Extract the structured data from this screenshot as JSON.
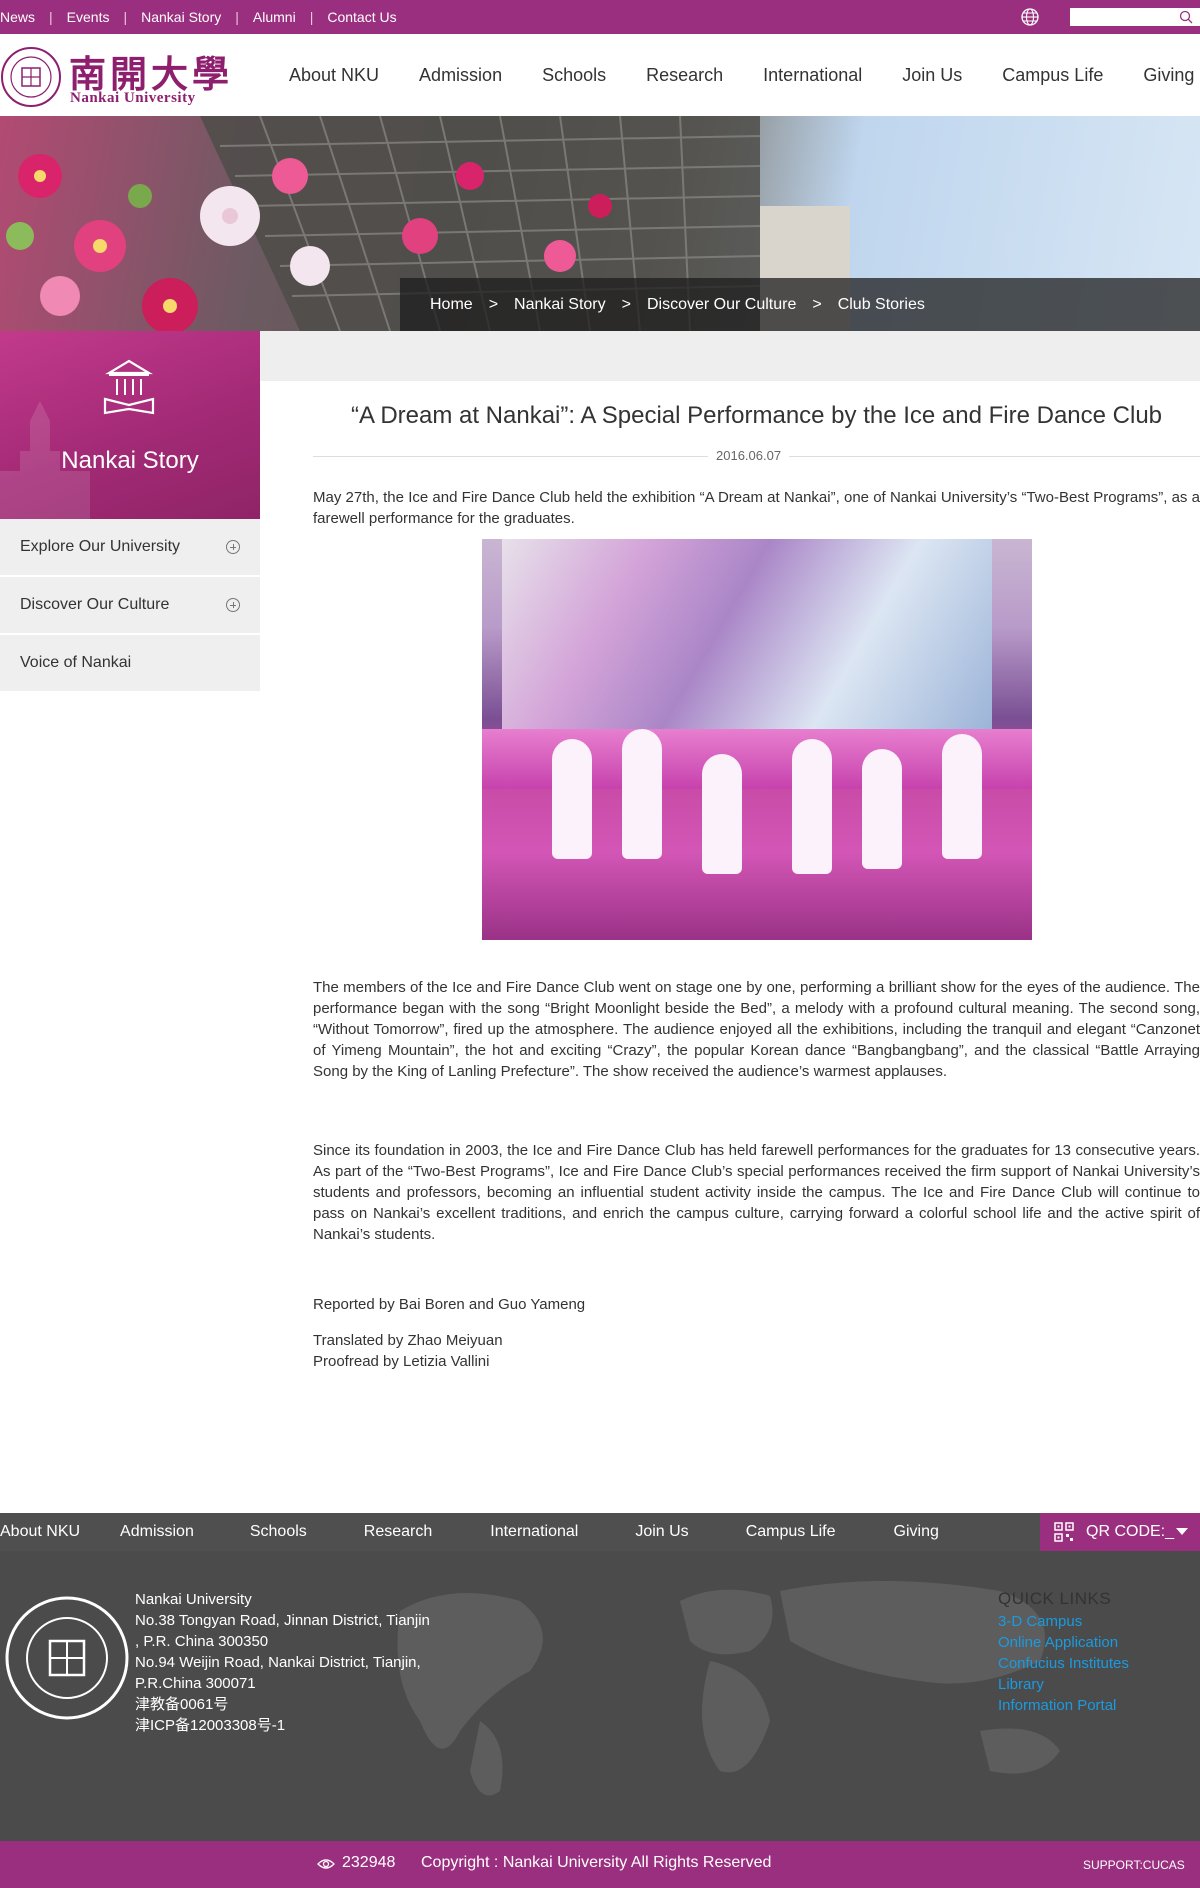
{
  "topbar": {
    "links": [
      "News",
      "Events",
      "Nankai Story",
      "Alumni",
      "Contact Us"
    ],
    "separator": "|",
    "search": {
      "placeholder": ""
    }
  },
  "header": {
    "logo_cn": "南開大學",
    "logo_en": "Nankai University",
    "nav": [
      "About NKU",
      "Admission",
      "Schools",
      "Research",
      "International",
      "Join Us",
      "Campus Life",
      "Giving"
    ]
  },
  "breadcrumb": {
    "items": [
      "Home",
      "Nankai Story",
      "Discover Our Culture",
      "Club Stories"
    ],
    "separator": ">"
  },
  "sidebar": {
    "title": "Nankai Story",
    "items": [
      {
        "label": "Explore Our University",
        "expandable": true
      },
      {
        "label": "Discover Our Culture",
        "expandable": true
      },
      {
        "label": "Voice of Nankai",
        "expandable": false
      }
    ]
  },
  "article": {
    "title": "“A Dream at Nankai”: A Special Performance by the Ice and Fire Dance Club",
    "date": "2016.06.07",
    "intro": "May 27th, the Ice and Fire Dance Club held the exhibition “A Dream at Nankai”, one of Nankai University’s “Two-Best Programs”, as a farewell performance for the graduates.",
    "body1": "The members of the Ice and Fire Dance Club went on stage one by one, performing a brilliant show for the eyes of the audience. The performance began with the song “Bright Moonlight beside the Bed”, a melody with a profound cultural meaning. The second song, “Without Tomorrow”, fired up the atmosphere. The audience enjoyed all the exhibitions, including the tranquil and elegant “Canzonet of Yimeng Mountain”, the hot and exciting “Crazy”, the popular Korean dance “Bangbangbang”, and the classical “Battle Arraying Song by the King of Lanling Prefecture”. The show received the audience’s warmest applauses.",
    "body2": "Since its foundation in 2003, the Ice and Fire Dance Club has held farewell performances for the graduates for 13 consecutive years. As part of the “Two-Best Programs”, Ice and Fire Dance Club’s special performances received the firm support of Nankai University’s students and professors, becoming an influential student activity inside the campus. The Ice and Fire Dance Club will continue to pass on Nankai’s excellent traditions, and enrich the campus culture, carrying forward a colorful school life and the active spirit of Nankai’s students.",
    "reported": "Reported by Bai Boren and Guo Yameng",
    "translated": "Translated by Zhao Meiyuan",
    "proofread": "Proofread by Letizia Vallini"
  },
  "footer_nav": {
    "items": [
      "About NKU",
      "Admission",
      "Schools",
      "Research",
      "International",
      "Join Us",
      "Campus Life",
      "Giving"
    ],
    "qr_label": "QR CODE:_"
  },
  "footer": {
    "address_lines": [
      "Nankai University",
      "No.38 Tongyan Road, Jinnan District, Tianjin",
      ", P.R. China 300350",
      "No.94 Weijin Road,  Nankai District, Tianjin,",
      "P.R.China  300071",
      "津教备0061号",
      "津ICP备12003308号-1"
    ],
    "quick_links_title": "QUICK LINKS",
    "quick_links": [
      "3-D Campus",
      "Online Application",
      "Confucius Institutes",
      "Library",
      "Information Portal"
    ]
  },
  "bottombar": {
    "visits": "232948",
    "copyright": "Copyright : Nankai University All Rights Reserved",
    "support": "SUPPORT:CUCAS"
  },
  "colors": {
    "brand": "#9b2f7f",
    "footer_bg": "#4b4b4b",
    "link": "#1a9be0"
  }
}
